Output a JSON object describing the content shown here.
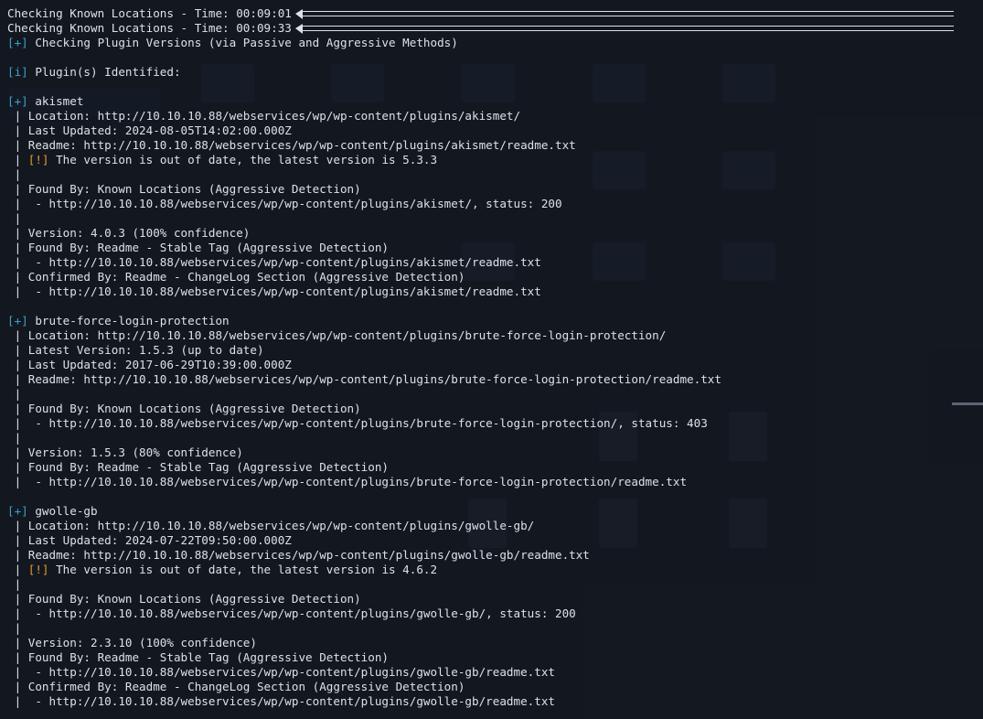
{
  "terminal": {
    "lines": [
      {
        "prefix": "",
        "text": "Checking Known Locations - Time: 00:09:01",
        "kind": "progress"
      },
      {
        "prefix": "",
        "text": "Checking Known Locations - Time: 00:09:33",
        "kind": "progress"
      },
      {
        "prefix": "[+]",
        "text": " Checking Plugin Versions (via Passive and Aggressive Methods)",
        "kind": "plus"
      },
      {
        "prefix": "",
        "text": "",
        "kind": "blank"
      },
      {
        "prefix": "[i]",
        "text": " Plugin(s) Identified:",
        "kind": "info"
      },
      {
        "prefix": "",
        "text": "",
        "kind": "blank"
      },
      {
        "prefix": "[+]",
        "text": " akismet",
        "kind": "plus"
      },
      {
        "prefix": "",
        "text": " | Location: http://10.10.10.88/webservices/wp/wp-content/plugins/akismet/",
        "kind": "text"
      },
      {
        "prefix": "",
        "text": " | Last Updated: 2024-08-05T14:02:00.000Z",
        "kind": "text"
      },
      {
        "prefix": "",
        "text": " | Readme: http://10.10.10.88/webservices/wp/wp-content/plugins/akismet/readme.txt",
        "kind": "text"
      },
      {
        "prefix": " | ",
        "text": "[!]",
        "suffix": " The version is out of date, the latest version is 5.3.3",
        "kind": "warn"
      },
      {
        "prefix": "",
        "text": " |",
        "kind": "text"
      },
      {
        "prefix": "",
        "text": " | Found By: Known Locations (Aggressive Detection)",
        "kind": "text"
      },
      {
        "prefix": "",
        "text": " |  - http://10.10.10.88/webservices/wp/wp-content/plugins/akismet/, status: 200",
        "kind": "text"
      },
      {
        "prefix": "",
        "text": " |",
        "kind": "text"
      },
      {
        "prefix": "",
        "text": " | Version: 4.0.3 (100% confidence)",
        "kind": "text"
      },
      {
        "prefix": "",
        "text": " | Found By: Readme - Stable Tag (Aggressive Detection)",
        "kind": "text"
      },
      {
        "prefix": "",
        "text": " |  - http://10.10.10.88/webservices/wp/wp-content/plugins/akismet/readme.txt",
        "kind": "text"
      },
      {
        "prefix": "",
        "text": " | Confirmed By: Readme - ChangeLog Section (Aggressive Detection)",
        "kind": "text"
      },
      {
        "prefix": "",
        "text": " |  - http://10.10.10.88/webservices/wp/wp-content/plugins/akismet/readme.txt",
        "kind": "text"
      },
      {
        "prefix": "",
        "text": "",
        "kind": "blank"
      },
      {
        "prefix": "[+]",
        "text": " brute-force-login-protection",
        "kind": "plus"
      },
      {
        "prefix": "",
        "text": " | Location: http://10.10.10.88/webservices/wp/wp-content/plugins/brute-force-login-protection/",
        "kind": "text"
      },
      {
        "prefix": "",
        "text": " | Latest Version: 1.5.3 (up to date)",
        "kind": "text"
      },
      {
        "prefix": "",
        "text": " | Last Updated: 2017-06-29T10:39:00.000Z",
        "kind": "text"
      },
      {
        "prefix": "",
        "text": " | Readme: http://10.10.10.88/webservices/wp/wp-content/plugins/brute-force-login-protection/readme.txt",
        "kind": "text"
      },
      {
        "prefix": "",
        "text": " |",
        "kind": "text"
      },
      {
        "prefix": "",
        "text": " | Found By: Known Locations (Aggressive Detection)",
        "kind": "text"
      },
      {
        "prefix": "",
        "text": " |  - http://10.10.10.88/webservices/wp/wp-content/plugins/brute-force-login-protection/, status: 403",
        "kind": "text"
      },
      {
        "prefix": "",
        "text": " |",
        "kind": "text"
      },
      {
        "prefix": "",
        "text": " | Version: 1.5.3 (80% confidence)",
        "kind": "text"
      },
      {
        "prefix": "",
        "text": " | Found By: Readme - Stable Tag (Aggressive Detection)",
        "kind": "text"
      },
      {
        "prefix": "",
        "text": " |  - http://10.10.10.88/webservices/wp/wp-content/plugins/brute-force-login-protection/readme.txt",
        "kind": "text"
      },
      {
        "prefix": "",
        "text": "",
        "kind": "blank"
      },
      {
        "prefix": "[+]",
        "text": " gwolle-gb",
        "kind": "plus"
      },
      {
        "prefix": "",
        "text": " | Location: http://10.10.10.88/webservices/wp/wp-content/plugins/gwolle-gb/",
        "kind": "text"
      },
      {
        "prefix": "",
        "text": " | Last Updated: 2024-07-22T09:50:00.000Z",
        "kind": "text"
      },
      {
        "prefix": "",
        "text": " | Readme: http://10.10.10.88/webservices/wp/wp-content/plugins/gwolle-gb/readme.txt",
        "kind": "text"
      },
      {
        "prefix": " | ",
        "text": "[!]",
        "suffix": " The version is out of date, the latest version is 4.6.2",
        "kind": "warn"
      },
      {
        "prefix": "",
        "text": " |",
        "kind": "text"
      },
      {
        "prefix": "",
        "text": " | Found By: Known Locations (Aggressive Detection)",
        "kind": "text"
      },
      {
        "prefix": "",
        "text": " |  - http://10.10.10.88/webservices/wp/wp-content/plugins/gwolle-gb/, status: 200",
        "kind": "text"
      },
      {
        "prefix": "",
        "text": " |",
        "kind": "text"
      },
      {
        "prefix": "",
        "text": " | Version: 2.3.10 (100% confidence)",
        "kind": "text"
      },
      {
        "prefix": "",
        "text": " | Found By: Readme - Stable Tag (Aggressive Detection)",
        "kind": "text"
      },
      {
        "prefix": "",
        "text": " |  - http://10.10.10.88/webservices/wp/wp-content/plugins/gwolle-gb/readme.txt",
        "kind": "text"
      },
      {
        "prefix": "",
        "text": " | Confirmed By: Readme - ChangeLog Section (Aggressive Detection)",
        "kind": "text"
      },
      {
        "prefix": "",
        "text": " |  - http://10.10.10.88/webservices/wp/wp-content/plugins/gwolle-gb/readme.txt",
        "kind": "text"
      }
    ]
  },
  "colors": {
    "background": "#141a24",
    "text": "#dde1e7",
    "prefix_blue": "#3aa3c9",
    "warning_orange": "#e89a2f"
  }
}
